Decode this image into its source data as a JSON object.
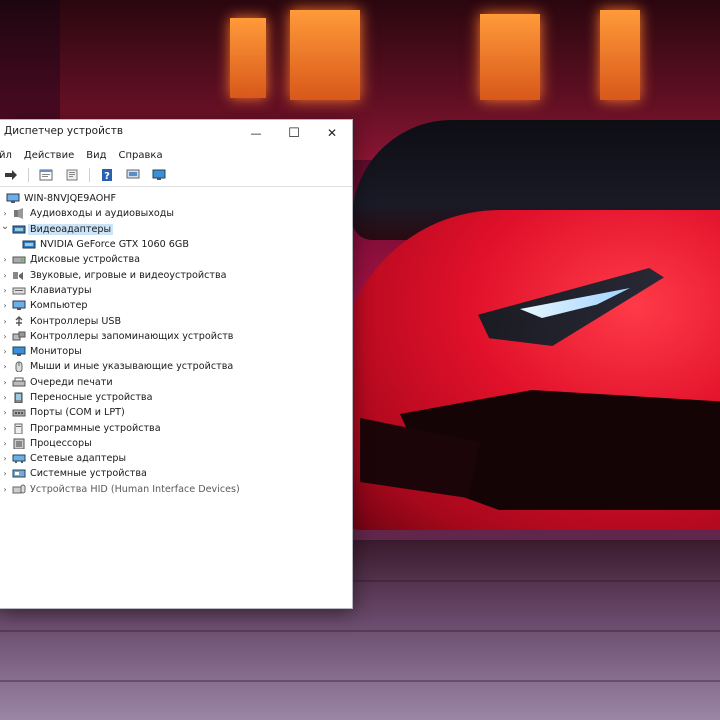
{
  "window": {
    "title": "Диспетчер устройств",
    "controls": {
      "minimize": "—",
      "maximize": "☐",
      "close": "✕"
    }
  },
  "menu": [
    "йл",
    "Действие",
    "Вид",
    "Справка"
  ],
  "toolbar": {
    "icons": [
      "forward-arrow-icon",
      "properties-icon",
      "driver-icon",
      "help-icon",
      "computer-icon",
      "monitor-icon"
    ]
  },
  "tree": {
    "root": "WIN-8NVJQE9AOHF",
    "categories": [
      {
        "label": "Аудиовходы и аудиовыходы",
        "icon": "audio-icon",
        "expanded": false
      },
      {
        "label": "Видеоадаптеры",
        "icon": "display-adapter-icon",
        "expanded": true,
        "selected": true,
        "children": [
          "NVIDIA GeForce GTX 1060 6GB"
        ]
      },
      {
        "label": "Дисковые устройства",
        "icon": "disk-icon",
        "expanded": false
      },
      {
        "label": "Звуковые, игровые и видеоустройства",
        "icon": "sound-icon",
        "expanded": false
      },
      {
        "label": "Клавиатуры",
        "icon": "keyboard-icon",
        "expanded": false
      },
      {
        "label": "Компьютер",
        "icon": "computer-icon",
        "expanded": false
      },
      {
        "label": "Контроллеры USB",
        "icon": "usb-icon",
        "expanded": false
      },
      {
        "label": "Контроллеры запоминающих устройств",
        "icon": "storage-controller-icon",
        "expanded": false
      },
      {
        "label": "Мониторы",
        "icon": "monitor-icon",
        "expanded": false
      },
      {
        "label": "Мыши и иные указывающие устройства",
        "icon": "mouse-icon",
        "expanded": false
      },
      {
        "label": "Очереди печати",
        "icon": "printer-icon",
        "expanded": false
      },
      {
        "label": "Переносные устройства",
        "icon": "portable-device-icon",
        "expanded": false
      },
      {
        "label": "Порты (COM и LPT)",
        "icon": "port-icon",
        "expanded": false
      },
      {
        "label": "Программные устройства",
        "icon": "software-device-icon",
        "expanded": false
      },
      {
        "label": "Процессоры",
        "icon": "processor-icon",
        "expanded": false
      },
      {
        "label": "Сетевые адаптеры",
        "icon": "network-adapter-icon",
        "expanded": false
      },
      {
        "label": "Системные устройства",
        "icon": "system-device-icon",
        "expanded": false
      },
      {
        "label": "Устройства HID (Human Interface Devices)",
        "icon": "hid-icon",
        "expanded": false
      }
    ]
  },
  "colors": {
    "selection": "#cce4f7",
    "accent": "#0078d7",
    "car_red": "#e0102a"
  }
}
